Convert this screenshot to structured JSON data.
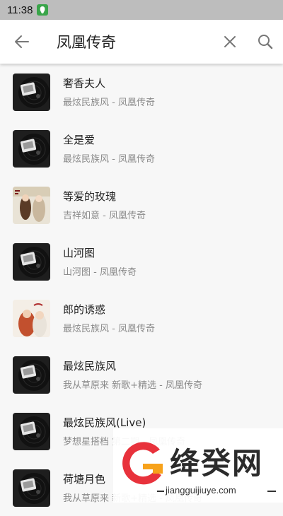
{
  "status": {
    "time": "11:38"
  },
  "search": {
    "query": "凤凰传奇"
  },
  "results": [
    {
      "title": "奢香夫人",
      "subtitle": "最炫民族风 - 凤凰传奇",
      "cover": "disc"
    },
    {
      "title": "全是爱",
      "subtitle": "最炫民族风 - 凤凰传奇",
      "cover": "disc"
    },
    {
      "title": "等爱的玫瑰",
      "subtitle": "吉祥如意 - 凤凰传奇",
      "cover": "photo-light"
    },
    {
      "title": "山河图",
      "subtitle": "山河图 - 凤凰传奇",
      "cover": "disc"
    },
    {
      "title": "郎的诱惑",
      "subtitle": "最炫民族风 - 凤凰传奇",
      "cover": "photo-warm"
    },
    {
      "title": "最炫民族风",
      "subtitle": "我从草原来 新歌+精选 - 凤凰传奇",
      "cover": "disc"
    },
    {
      "title": "最炫民族风(Live)",
      "subtitle": "梦想星搭档 第二期 - 凤凰传奇",
      "cover": "disc"
    },
    {
      "title": "荷塘月色",
      "subtitle": "我从草原来 新歌+精选 - 凤凰传奇",
      "cover": "disc"
    }
  ],
  "watermark": {
    "name": "绛癸网",
    "url": "jiangguijiuye.com"
  },
  "colors": {
    "status_bar": "#bdbdbd",
    "accent_red": "#e8323c",
    "accent_orange": "#f7a21b"
  }
}
